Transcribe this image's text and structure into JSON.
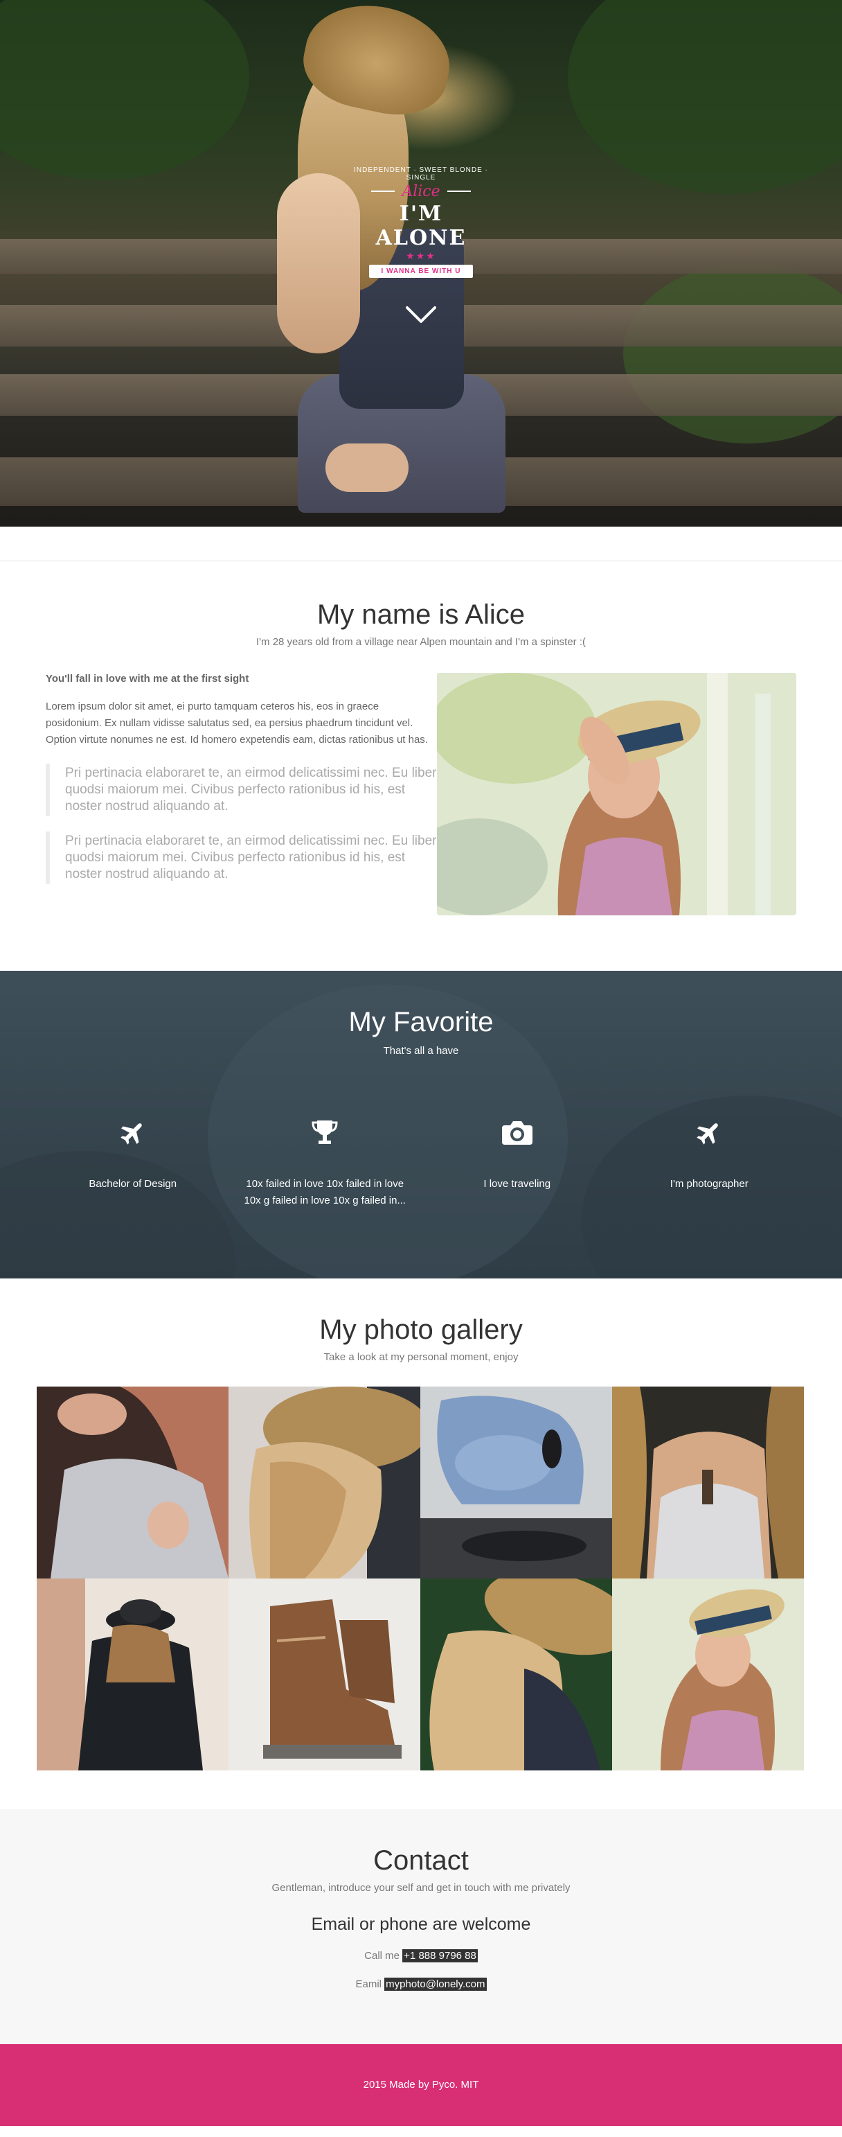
{
  "hero": {
    "badge_arc": "INDEPENDENT · SWEET BLONDE · SINGLE",
    "badge_script": "Alice",
    "badge_title": "I'M ALONE",
    "badge_stars": "★★★",
    "badge_ribbon": "I WANNA BE WITH U",
    "scroll_icon": "chevron-down-icon"
  },
  "about": {
    "title": "My name is Alice",
    "subtitle": "I'm 28 years old from a village near Alpen mountain and I'm a spinster :(",
    "lead": "You'll fall in love with me at the first sight",
    "body": "Lorem ipsum dolor sit amet, ei purto tamquam ceteros his, eos in graece posidonium. Ex nullam vidisse salutatus sed, ea persius phaedrum tincidunt vel. Option virtute nonumes ne est. Id homero expetendis eam, dictas rationibus ut has.",
    "quotes": [
      "Pri pertinacia elaboraret te, an eirmod delicatissimi nec. Eu liber quodsi maiorum mei. Civibus perfecto rationibus id his, est noster nostrud aliquando at.",
      "Pri pertinacia elaboraret te, an eirmod delicatissimi nec. Eu liber quodsi maiorum mei. Civibus perfecto rationibus id his, est noster nostrud aliquando at."
    ]
  },
  "favorite": {
    "title": "My Favorite",
    "subtitle": "That's all a have",
    "items": [
      {
        "icon": "plane-icon",
        "label": "Bachelor of Design"
      },
      {
        "icon": "trophy-icon",
        "label": "10x failed in love 10x failed in love 10x g failed in love 10x g failed in..."
      },
      {
        "icon": "camera-icon",
        "label": "I love traveling"
      },
      {
        "icon": "plane-icon",
        "label": "I'm photographer"
      }
    ]
  },
  "gallery": {
    "title": "My photo gallery",
    "subtitle": "Take a look at my personal moment, enjoy"
  },
  "contact": {
    "title": "Contact",
    "subtitle": "Gentleman, introduce your self and get in touch with me privately",
    "heading": "Email or phone are welcome",
    "phone_label": "Call me",
    "phone": "+1 888 9796 88",
    "email_label": "Eamil",
    "email": "myphoto@lonely.com"
  },
  "footer": {
    "text": "2015 Made by Pyco. MIT"
  },
  "colors": {
    "accent": "#d82e74",
    "favorite_bg": "#3e4f59",
    "contact_bg": "#f7f7f7"
  }
}
